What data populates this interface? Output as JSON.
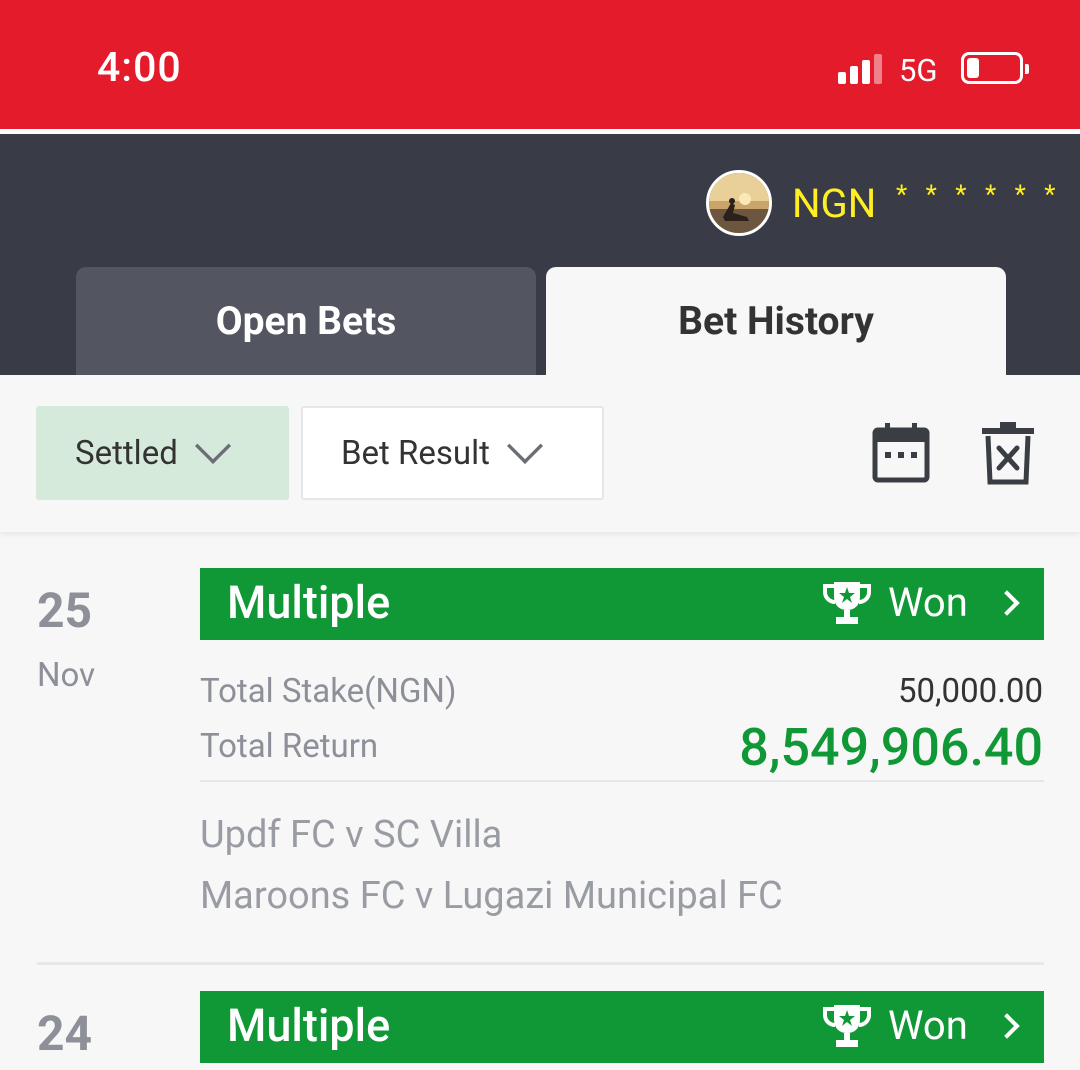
{
  "status_bar": {
    "time": "4:00",
    "network": "5G",
    "colors": {
      "background": "#e41b2b"
    }
  },
  "header": {
    "currency": "NGN",
    "balance_mask": "* * * * * *",
    "avatar_icon": "user-avatar-photo"
  },
  "tabs": [
    {
      "label": "Open Bets",
      "active": false
    },
    {
      "label": "Bet History",
      "active": true
    }
  ],
  "filters": {
    "settled_label": "Settled",
    "result_label": "Bet Result",
    "calendar_icon": "calendar-icon",
    "clear_icon": "trash-x-icon"
  },
  "bets": [
    {
      "day": "25",
      "month": "Nov",
      "type": "Multiple",
      "status": "Won",
      "stake_label": "Total Stake(NGN)",
      "stake_value": "50,000.00",
      "return_label": "Total Return",
      "return_value": "8,549,906.40",
      "matches": [
        "Updf FC v SC Villa",
        "Maroons FC v Lugazi Municipal FC"
      ]
    },
    {
      "day": "24",
      "type": "Multiple",
      "status": "Won"
    }
  ],
  "colors": {
    "won_green": "#109836",
    "header_dark": "#393c47",
    "accent_yellow": "#ffee22"
  }
}
